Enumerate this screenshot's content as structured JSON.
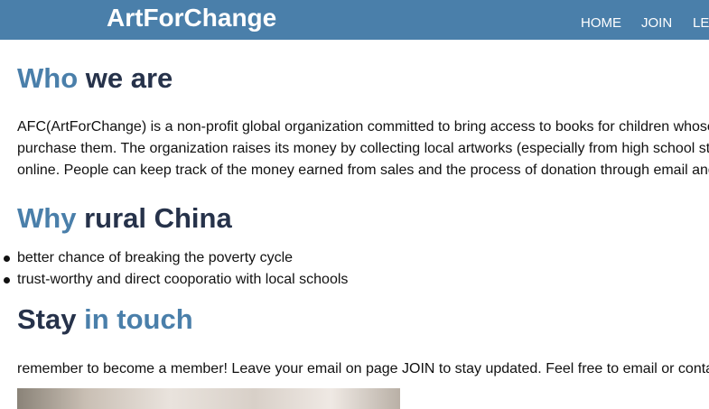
{
  "header": {
    "brand": "ArtForChange",
    "nav": [
      "HOME",
      "JOIN",
      "LE"
    ]
  },
  "who": {
    "title_part1": "Who",
    "title_part2": "we are",
    "lines": [
      "AFC(ArtForChange) is a non-profit global organization committed to bring access to books for children whose",
      "purchase them. The organization raises its money by collecting local artworks (especially from high school st",
      "online. People can keep track of the money earned from sales and the process of donation through email and"
    ]
  },
  "why": {
    "title_part1": "Why",
    "title_part2": "rural China",
    "bullets": [
      "better chance of breaking the poverty cycle",
      "trust-worthy and direct cooporatio with local schools"
    ]
  },
  "stay": {
    "title_part1": "Stay",
    "title_part2": "in touch",
    "text": "remember to become a member! Leave your email on page JOIN to stay updated. Feel free to email or conta"
  },
  "colors": {
    "accent": "#4a7faa",
    "dark_heading": "#26324a",
    "navbar": "#4a7faa"
  }
}
